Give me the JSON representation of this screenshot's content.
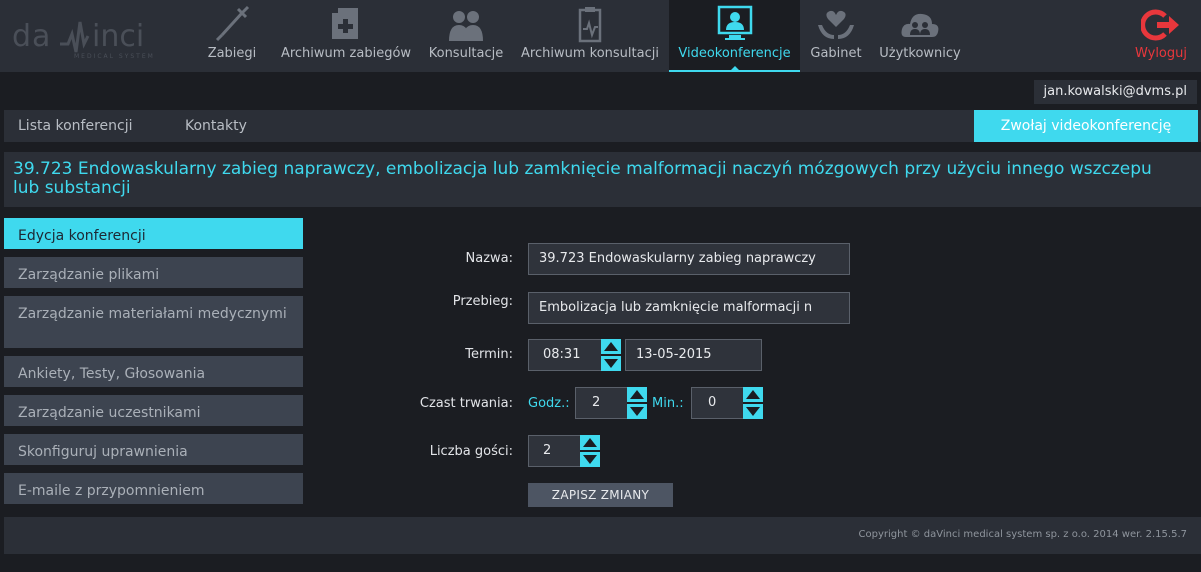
{
  "brand": {
    "logo_text": "da Vinci",
    "logo_tagline": "MEDICAL SYSTEM"
  },
  "nav": {
    "items": [
      {
        "label": "Zabiegi",
        "icon": "syringe-icon"
      },
      {
        "label": "Archiwum zabiegów",
        "icon": "medical-case-icon"
      },
      {
        "label": "Konsultacje",
        "icon": "doctors-icon"
      },
      {
        "label": "Archiwum konsultacji",
        "icon": "clipboard-chart-icon"
      },
      {
        "label": "Videokonferencje",
        "icon": "video-conference-icon",
        "active": true
      },
      {
        "label": "Gabinet",
        "icon": "hands-heart-icon"
      },
      {
        "label": "Użytkownicy",
        "icon": "users-cloud-icon"
      }
    ],
    "logout_label": "Wyloguj"
  },
  "user": {
    "email": "jan.kowalski@dvms.pl"
  },
  "subnav": {
    "tabs": [
      "Lista konferencji",
      "Kontakty"
    ],
    "call_button": "Zwołaj videokonferencję"
  },
  "page_title": "39.723 Endowaskularny zabieg naprawczy, embolizacja lub zamknięcie malformacji naczyń mózgowych przy użyciu innego wszczepu lub substancji",
  "side_menu": [
    "Edycja konferencji",
    "Zarządzanie plikami",
    "Zarządzanie materiałami medycznymi",
    "Ankiety, Testy, Głosowania",
    "Zarządzanie uczestnikami",
    "Skonfiguruj uprawnienia",
    "E-maile z przypomnieniem"
  ],
  "form": {
    "name_label": "Nazwa:",
    "name_value": "39.723 Endowaskularny zabieg naprawczy",
    "course_label": "Przebieg:",
    "course_value": "Embolizacja lub zamknięcie malformacji n",
    "term_label": "Termin:",
    "time_value": "08:31",
    "date_value": "13-05-2015",
    "duration_label": "Czast trwania:",
    "hours_label": "Godz.:",
    "hours_value": "2",
    "minutes_label": "Min.:",
    "minutes_value": "0",
    "guests_label": "Liczba gości:",
    "guests_value": "2",
    "save_button": "ZAPISZ ZMIANY"
  },
  "footer": {
    "copyright": "Copyright © daVinci medical system sp. z o.o. 2014 wer. 2.15.5.7"
  },
  "colors": {
    "accent": "#3fd9ee",
    "logout": "#e8373c",
    "panel": "#2b2f37",
    "background": "#1b1d22"
  }
}
